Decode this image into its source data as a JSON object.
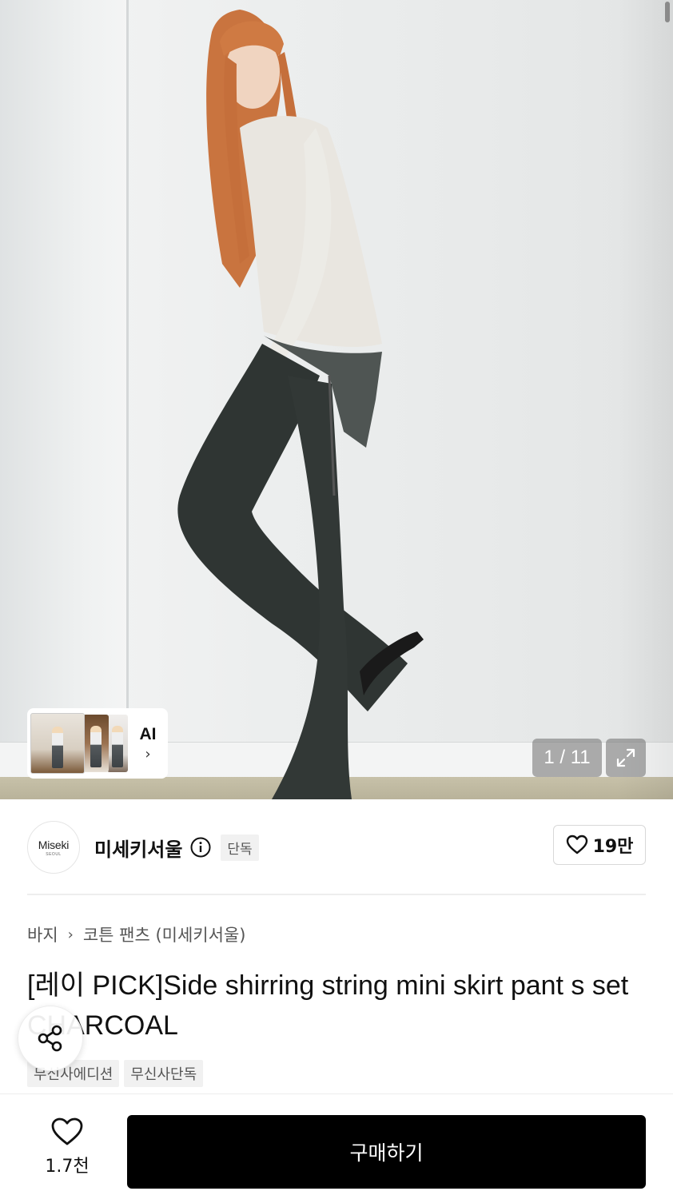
{
  "gallery": {
    "counter": "1 / 11",
    "ai_label": "AI",
    "ai_chevron": "›",
    "icons": {
      "expand": "expand-icon",
      "chevron": "chevron-right-icon"
    }
  },
  "brand": {
    "logo_main": "Miseki",
    "logo_sub": "SEOUL",
    "name": "미세키서울",
    "badge": "단독",
    "like_count": "19만",
    "icons": {
      "info": "info-icon",
      "heart": "heart-icon"
    }
  },
  "product": {
    "breadcrumb": [
      "바지",
      "코튼 팬츠 (미세키서울)"
    ],
    "breadcrumb_sep": "›",
    "title": "[레이 PICK]Side shirring string mini skirt pant s set CHARCOAL",
    "tags": [
      "무신사에디션",
      "무신사단독"
    ]
  },
  "actions": {
    "wish_count": "1.7천",
    "buy_label": "구매하기",
    "icons": {
      "share": "share-icon",
      "wish": "heart-icon"
    }
  },
  "colors": {
    "accent": "#000000",
    "badge_bg": "#f1f1f1"
  }
}
